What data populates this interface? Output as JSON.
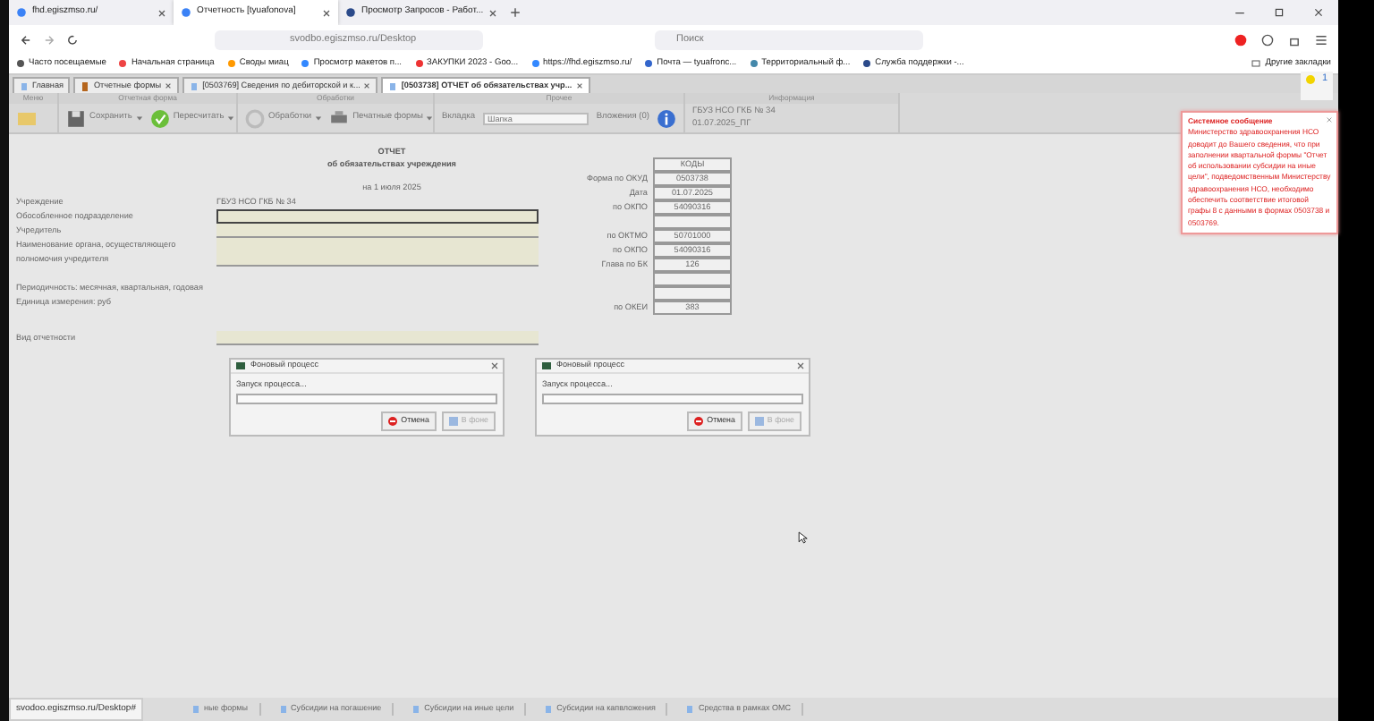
{
  "browser_tabs": [
    {
      "label": "fhd.egiszmso.ru/",
      "selected": false
    },
    {
      "label": "Отчетность [tyuafonova]",
      "selected": true
    },
    {
      "label": "Просмотр Запросов - Работ...",
      "selected": false
    }
  ],
  "address": "svodbo.egiszmso.ru/Desktop",
  "search_placeholder": "Поиск",
  "bookmarks": [
    "Часто посещаемые",
    "Начальная страница",
    "Своды миац",
    "Просмотр макетов п...",
    "ЗАКУПКИ 2023 - Goo...",
    "https://fhd.egiszmso.ru/",
    "Почта — tyuafronc...",
    "Территориальный ф...",
    "Служба поддержки -..."
  ],
  "other_bookmarks": "Другие закладки",
  "app_tabs": [
    {
      "label": "Главная",
      "selected": false,
      "closable": false
    },
    {
      "label": "Отчетные формы",
      "selected": false,
      "closable": true
    },
    {
      "label": "[0503769] Сведения по дебиторской и к...",
      "selected": false,
      "closable": true
    },
    {
      "label": "[0503738] ОТЧЕТ об обязательствах учр...",
      "selected": true,
      "closable": true
    }
  ],
  "toolbar": {
    "groups": [
      {
        "title": "Меню",
        "kind": "menu"
      },
      {
        "title": "Отчетная форма",
        "kind": "form",
        "buttons": [
          "Сохранить",
          "Пересчитать"
        ]
      },
      {
        "title": "Обработки",
        "kind": "processing",
        "buttons": [
          "Обработки",
          "Печатные формы"
        ]
      },
      {
        "title": "Прочее",
        "kind": "other",
        "tab_label": "Вкладка",
        "tab_value": "Шапка",
        "attachments": "Вложения (0)"
      },
      {
        "title": "Информация",
        "kind": "info",
        "lines": [
          "ГБУЗ НСО ГКБ № 34",
          "01.07.2025_ПГ"
        ]
      }
    ]
  },
  "notification": {
    "count": "1",
    "title": "Системное сообщение",
    "text": "Министерство здравоохранения НСО доводит до Вашего сведения, что при заполнении квартальной формы \"Отчет об использовании субсидии на иные цели\", подведомственным Министерству здравоохранения НСО, необходимо обеспечить соответствие итоговой графы 8 с данными в формах 0503738 и 0503769."
  },
  "report": {
    "title": "ОТЧЕТ",
    "subtitle": "об обязательствах учреждения",
    "date_line": "на 1 июля 2025",
    "fields": [
      {
        "label": "Учреждение",
        "kind": "text",
        "value": "ГБУЗ НСО ГКБ № 34"
      },
      {
        "label": "Обособленное подразделение",
        "kind": "input",
        "focused": true
      },
      {
        "label": "Учредитель",
        "kind": "input",
        "focused": false
      },
      {
        "label": "Наименование органа, осуществляющего полномочия учредителя",
        "kind": "tall",
        "focused": false
      },
      {
        "label": "Периодичность: месячная, квартальная, годовая",
        "kind": "text"
      },
      {
        "label": "Единица измерения: руб",
        "kind": "text"
      },
      {
        "label": "Вид отчетности",
        "kind": "input",
        "focused": false
      }
    ],
    "codes_header": "КОДЫ",
    "codes": [
      {
        "kind": "code",
        "label": "Форма по ОКУД",
        "code": "0503738"
      },
      {
        "kind": "code",
        "label": "Дата",
        "code": "01.07.2025"
      },
      {
        "kind": "code",
        "label": "по ОКПО",
        "code": "54090316"
      },
      {
        "kind": "blank"
      },
      {
        "kind": "code",
        "label": "по ОКТМО",
        "code": "50701000"
      },
      {
        "kind": "code",
        "label": "по ОКПО",
        "code": "54090316"
      },
      {
        "kind": "code",
        "label": "Глава по БК",
        "code": "126"
      },
      {
        "kind": "blank"
      },
      {
        "kind": "blank"
      },
      {
        "kind": "code",
        "label": "по ОКЕИ",
        "code": "383"
      }
    ]
  },
  "dialogs": [
    {
      "title": "Фоновый процесс",
      "message": "Запуск процесса...",
      "level": 0,
      "cancel": "Отмена",
      "background": "В фоне",
      "background_disabled": true
    },
    {
      "title": "Фоновый процесс",
      "message": "Запуск процесса...",
      "level": 0,
      "cancel": "Отмена",
      "background": "В фоне",
      "background_disabled": true
    }
  ],
  "status_url": "svodoo.egiszmso.ru/Desktop#",
  "bottom_tabs": [
    "ные формы",
    "Субсидии на погашение",
    "Субсидии на иные цели",
    "Субсидии на капвложения",
    "Средства в рамках ОМС"
  ]
}
